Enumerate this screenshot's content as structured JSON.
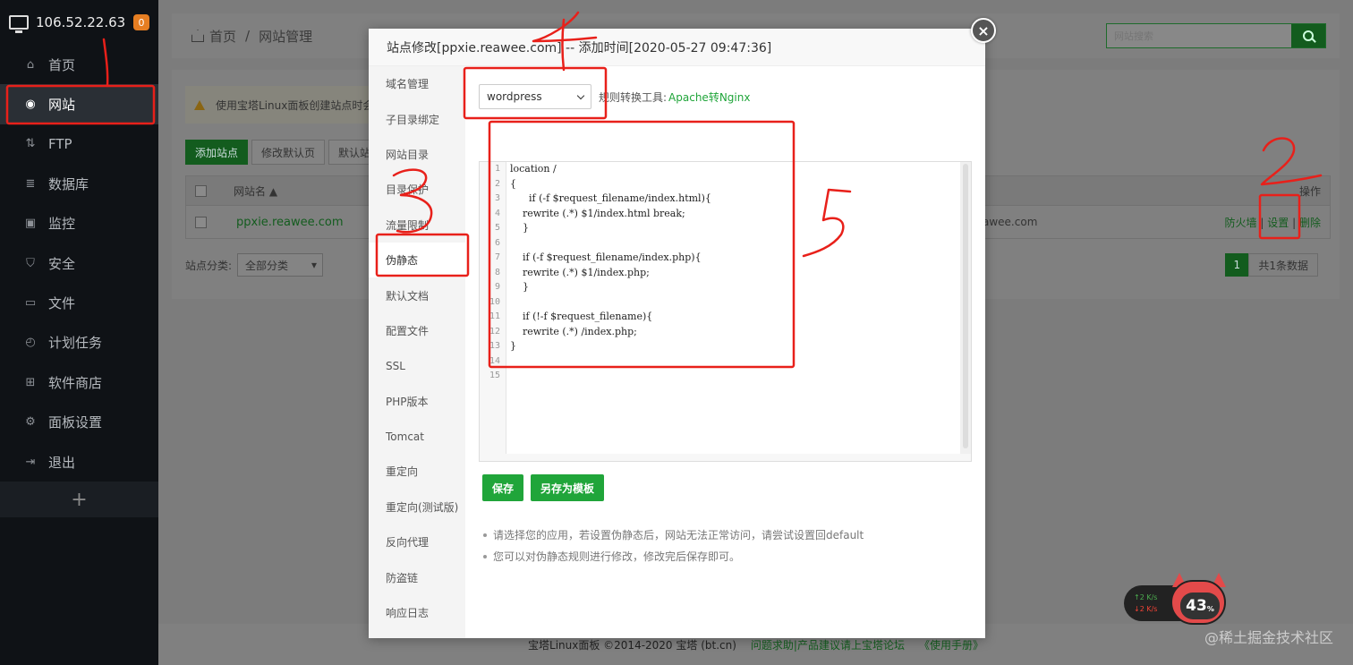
{
  "sidebar": {
    "ip": "106.52.22.63",
    "badge": "0",
    "items": [
      {
        "label": "首页",
        "icon": "home-icon"
      },
      {
        "label": "网站",
        "icon": "globe-icon"
      },
      {
        "label": "FTP",
        "icon": "ftp-icon"
      },
      {
        "label": "数据库",
        "icon": "database-icon"
      },
      {
        "label": "监控",
        "icon": "monitor-icon"
      },
      {
        "label": "安全",
        "icon": "shield-icon"
      },
      {
        "label": "文件",
        "icon": "folder-icon"
      },
      {
        "label": "计划任务",
        "icon": "clock-icon"
      },
      {
        "label": "软件商店",
        "icon": "grid-icon"
      },
      {
        "label": "面板设置",
        "icon": "gear-icon"
      },
      {
        "label": "退出",
        "icon": "logout-icon"
      }
    ],
    "add": "+"
  },
  "breadcrumb": {
    "home": "首页",
    "sep": "/",
    "current": "网站管理"
  },
  "search": {
    "placeholder": "网站搜索"
  },
  "panel": {
    "warning": "使用宝塔Linux面板创建站点时会",
    "buttons": {
      "add": "添加站点",
      "edit_default": "修改默认页",
      "default": "默认站"
    },
    "table": {
      "col_name": "网站名 ▲",
      "col_ops": "操作",
      "row": {
        "name": "ppxie.reawee.com",
        "domain_tail": "awee.com",
        "op1": "防火墙",
        "op2": "设置",
        "op3": "删除",
        "sep": "|"
      }
    },
    "filter_label": "站点分类:",
    "filter_value": "全部分类",
    "page": "1",
    "total": "共1条数据"
  },
  "modal": {
    "title": "站点修改[ppxie.reawee.com] -- 添加时间[2020-05-27 09:47:36]",
    "close": "×",
    "nav": [
      "域名管理",
      "子目录绑定",
      "网站目录",
      "目录保护",
      "流量限制",
      "伪静态",
      "默认文档",
      "配置文件",
      "SSL",
      "PHP版本",
      "Tomcat",
      "重定向",
      "重定向(测试版)",
      "反向代理",
      "防盗链",
      "响应日志"
    ],
    "active_nav_index": 5,
    "template": "wordpress",
    "tool_label": "规则转换工具:",
    "tool_link": "Apache转Nginx",
    "line_numbers": [
      "1",
      "2",
      "3",
      "4",
      "5",
      "6",
      "7",
      "8",
      "9",
      "10",
      "11",
      "12",
      "13",
      "14",
      "15"
    ],
    "code_lines": [
      "location /",
      "{",
      "      if (-f $request_filename/index.html){",
      "    rewrite (.*) $1/index.html break;",
      "    }",
      "",
      "    if (-f $request_filename/index.php){",
      "    rewrite (.*) $1/index.php;",
      "    }",
      "",
      "    if (!-f $request_filename){",
      "    rewrite (.*) /index.php;",
      "}",
      "",
      ""
    ],
    "save": "保存",
    "save_as": "另存为模板",
    "tips": [
      "请选择您的应用，若设置伪静态后，网站无法正常访问，请尝试设置回default",
      "您可以对伪静态规则进行修改，修改完后保存即可。"
    ]
  },
  "footer": {
    "copyright": "宝塔Linux面板 ©2014-2020 宝塔 (bt.cn)",
    "help": "问题求助|产品建议请上宝塔论坛",
    "manual": "《使用手册》"
  },
  "net_widget": {
    "up": "↑2  K/s",
    "down": "↓2  K/s",
    "percent": "43",
    "percent_unit": "%"
  },
  "watermark": "@稀土掘金技术社区",
  "annotation_marks": [
    "1",
    "2",
    "3",
    "4",
    "5"
  ]
}
